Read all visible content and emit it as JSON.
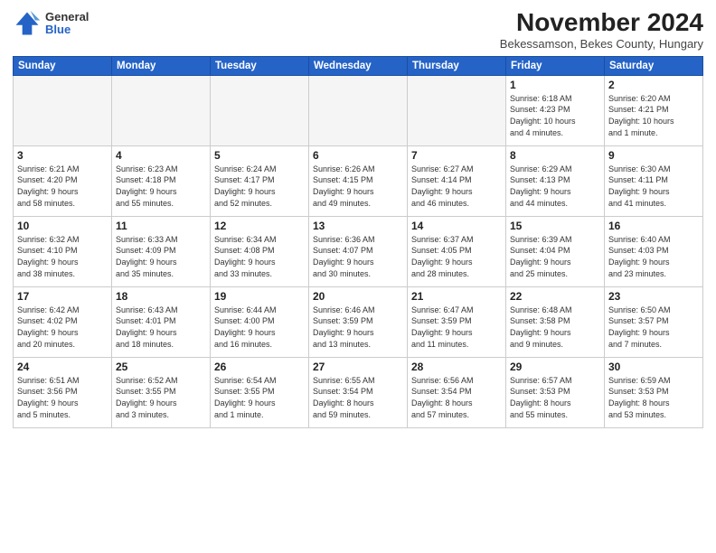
{
  "logo": {
    "general": "General",
    "blue": "Blue"
  },
  "title": "November 2024",
  "location": "Bekessamson, Bekes County, Hungary",
  "headers": [
    "Sunday",
    "Monday",
    "Tuesday",
    "Wednesday",
    "Thursday",
    "Friday",
    "Saturday"
  ],
  "weeks": [
    [
      {
        "day": "",
        "info": ""
      },
      {
        "day": "",
        "info": ""
      },
      {
        "day": "",
        "info": ""
      },
      {
        "day": "",
        "info": ""
      },
      {
        "day": "",
        "info": ""
      },
      {
        "day": "1",
        "info": "Sunrise: 6:18 AM\nSunset: 4:23 PM\nDaylight: 10 hours\nand 4 minutes."
      },
      {
        "day": "2",
        "info": "Sunrise: 6:20 AM\nSunset: 4:21 PM\nDaylight: 10 hours\nand 1 minute."
      }
    ],
    [
      {
        "day": "3",
        "info": "Sunrise: 6:21 AM\nSunset: 4:20 PM\nDaylight: 9 hours\nand 58 minutes."
      },
      {
        "day": "4",
        "info": "Sunrise: 6:23 AM\nSunset: 4:18 PM\nDaylight: 9 hours\nand 55 minutes."
      },
      {
        "day": "5",
        "info": "Sunrise: 6:24 AM\nSunset: 4:17 PM\nDaylight: 9 hours\nand 52 minutes."
      },
      {
        "day": "6",
        "info": "Sunrise: 6:26 AM\nSunset: 4:15 PM\nDaylight: 9 hours\nand 49 minutes."
      },
      {
        "day": "7",
        "info": "Sunrise: 6:27 AM\nSunset: 4:14 PM\nDaylight: 9 hours\nand 46 minutes."
      },
      {
        "day": "8",
        "info": "Sunrise: 6:29 AM\nSunset: 4:13 PM\nDaylight: 9 hours\nand 44 minutes."
      },
      {
        "day": "9",
        "info": "Sunrise: 6:30 AM\nSunset: 4:11 PM\nDaylight: 9 hours\nand 41 minutes."
      }
    ],
    [
      {
        "day": "10",
        "info": "Sunrise: 6:32 AM\nSunset: 4:10 PM\nDaylight: 9 hours\nand 38 minutes."
      },
      {
        "day": "11",
        "info": "Sunrise: 6:33 AM\nSunset: 4:09 PM\nDaylight: 9 hours\nand 35 minutes."
      },
      {
        "day": "12",
        "info": "Sunrise: 6:34 AM\nSunset: 4:08 PM\nDaylight: 9 hours\nand 33 minutes."
      },
      {
        "day": "13",
        "info": "Sunrise: 6:36 AM\nSunset: 4:07 PM\nDaylight: 9 hours\nand 30 minutes."
      },
      {
        "day": "14",
        "info": "Sunrise: 6:37 AM\nSunset: 4:05 PM\nDaylight: 9 hours\nand 28 minutes."
      },
      {
        "day": "15",
        "info": "Sunrise: 6:39 AM\nSunset: 4:04 PM\nDaylight: 9 hours\nand 25 minutes."
      },
      {
        "day": "16",
        "info": "Sunrise: 6:40 AM\nSunset: 4:03 PM\nDaylight: 9 hours\nand 23 minutes."
      }
    ],
    [
      {
        "day": "17",
        "info": "Sunrise: 6:42 AM\nSunset: 4:02 PM\nDaylight: 9 hours\nand 20 minutes."
      },
      {
        "day": "18",
        "info": "Sunrise: 6:43 AM\nSunset: 4:01 PM\nDaylight: 9 hours\nand 18 minutes."
      },
      {
        "day": "19",
        "info": "Sunrise: 6:44 AM\nSunset: 4:00 PM\nDaylight: 9 hours\nand 16 minutes."
      },
      {
        "day": "20",
        "info": "Sunrise: 6:46 AM\nSunset: 3:59 PM\nDaylight: 9 hours\nand 13 minutes."
      },
      {
        "day": "21",
        "info": "Sunrise: 6:47 AM\nSunset: 3:59 PM\nDaylight: 9 hours\nand 11 minutes."
      },
      {
        "day": "22",
        "info": "Sunrise: 6:48 AM\nSunset: 3:58 PM\nDaylight: 9 hours\nand 9 minutes."
      },
      {
        "day": "23",
        "info": "Sunrise: 6:50 AM\nSunset: 3:57 PM\nDaylight: 9 hours\nand 7 minutes."
      }
    ],
    [
      {
        "day": "24",
        "info": "Sunrise: 6:51 AM\nSunset: 3:56 PM\nDaylight: 9 hours\nand 5 minutes."
      },
      {
        "day": "25",
        "info": "Sunrise: 6:52 AM\nSunset: 3:55 PM\nDaylight: 9 hours\nand 3 minutes."
      },
      {
        "day": "26",
        "info": "Sunrise: 6:54 AM\nSunset: 3:55 PM\nDaylight: 9 hours\nand 1 minute."
      },
      {
        "day": "27",
        "info": "Sunrise: 6:55 AM\nSunset: 3:54 PM\nDaylight: 8 hours\nand 59 minutes."
      },
      {
        "day": "28",
        "info": "Sunrise: 6:56 AM\nSunset: 3:54 PM\nDaylight: 8 hours\nand 57 minutes."
      },
      {
        "day": "29",
        "info": "Sunrise: 6:57 AM\nSunset: 3:53 PM\nDaylight: 8 hours\nand 55 minutes."
      },
      {
        "day": "30",
        "info": "Sunrise: 6:59 AM\nSunset: 3:53 PM\nDaylight: 8 hours\nand 53 minutes."
      }
    ]
  ]
}
